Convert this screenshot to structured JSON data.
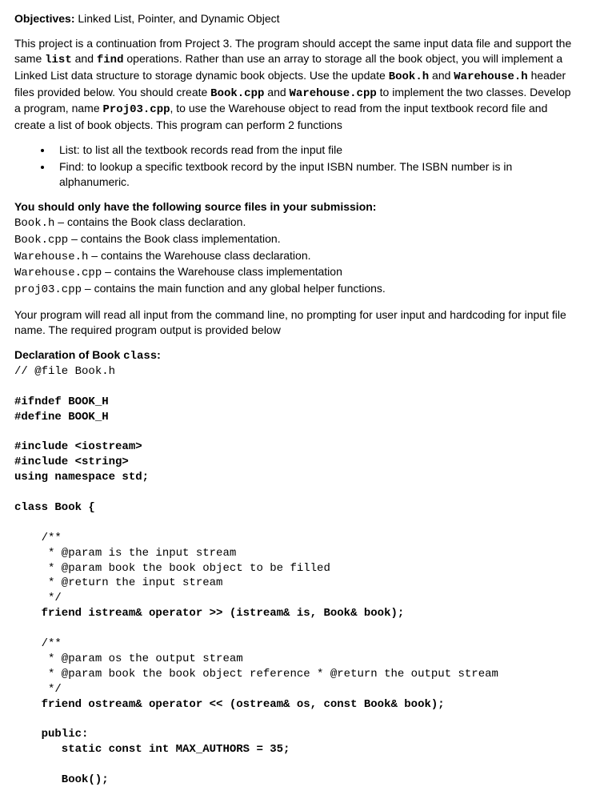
{
  "objectives": {
    "label": "Objectives:",
    "text": " Linked List, Pointer, and Dynamic Object"
  },
  "intro": {
    "p1a": "This project is a continuation from Project 3.  The program should accept the same input data file and support the same ",
    "p1_list": "list",
    "p1b": " and ",
    "p1_find": "find",
    "p1c": " operations. Rather than use an array to storage all the book object, you will implement a Linked List data structure to storage dynamic book objects. Use the update ",
    "p1_bookh": "Book.h",
    "p1d": " and ",
    "p1_wareh": "Warehouse.h",
    "p1e": " header files provided below. You should create ",
    "p1_bookcpp": "Book.cpp",
    "p1f": " and ",
    "p1_warecpp": "Warehouse.cpp",
    "p1g": " to implement the two classes. Develop a program, name ",
    "p1_proj": "Proj03.cpp",
    "p1h": ", to use the Warehouse object to read from the input textbook record file and create a list of book objects. This program can perform 2 functions"
  },
  "functions": {
    "item1": "List: to list all the textbook records read from the input file",
    "item2": "Find: to lookup a specific textbook record by the input ISBN number.  The ISBN number is in alphanumeric."
  },
  "submission": {
    "header": "You should only have the following source files in your submission:",
    "f1a": "Book.h",
    "f1b": " – contains the Book class declaration.",
    "f2a": "Book.cpp",
    "f2b": " – contains the Book class implementation.",
    "f3a": "Warehouse.h",
    "f3b": " – contains the Warehouse class declaration.",
    "f4a": "Warehouse.cpp",
    "f4b": " – contains the Warehouse class implementation",
    "f5a": "proj03.cpp",
    "f5b": " – contains the main function and any global helper functions."
  },
  "cmdline": "Your program will read all input from the command line, no prompting for user input and hardcoding for input file name.  The required program output is provided below",
  "declaration": {
    "pre": "Declaration of Book ",
    "class_word": "class",
    "post": ":"
  },
  "code": {
    "l01": "// @file Book.h",
    "l02": "",
    "l03a": "#ifndef BOOK_H",
    "l04a": "#define BOOK_H",
    "l05": "",
    "l06a": "#include <iostream>",
    "l07a": "#include <string>",
    "l08a": "using namespace std;",
    "l09": "",
    "l10a": "class Book {",
    "l11": "",
    "l12": "    /**",
    "l13": "     * @param is the input stream",
    "l14": "     * @param book the book object to be filled",
    "l15": "     * @return the input stream",
    "l16": "     */",
    "l17a": "    friend istream& operator >> (istream& is, Book& book);",
    "l18": "",
    "l19": "    /**",
    "l20": "     * @param os the output stream",
    "l21": "     * @param book the book object reference * @return the output stream",
    "l22": "     */",
    "l23a": "    friend ostream& operator << (ostream& os, const Book& book);",
    "l24": "",
    "l25a": "    public:",
    "l26a": "       static const int MAX_AUTHORS = 35;",
    "l27": "",
    "l28a": "       Book();"
  }
}
